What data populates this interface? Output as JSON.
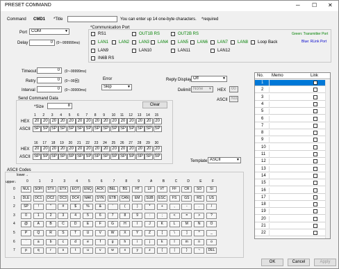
{
  "window": {
    "title": "PRESET COMMAND",
    "min": "─",
    "max": "☐",
    "close": "✕"
  },
  "command": {
    "label": "Command",
    "value": "CMD1",
    "title_label": "*Title",
    "title_value": "",
    "hint": "You can enter up 14 one-byte characters.",
    "required": "*required"
  },
  "port": {
    "label": "Port",
    "value": "COM",
    "comm_label": "*Communication Port"
  },
  "delay": {
    "label": "Delay",
    "value": "0",
    "range": "(0~-999999ms)"
  },
  "ports": [
    "RS1",
    "OUT1B RS",
    "OUT2B RS",
    "LAN1",
    "LAN2",
    "LAN3",
    "LAN4",
    "LAN5",
    "LAN6",
    "LAN7",
    "LAN8",
    "Loop Back",
    "LAN9",
    "LAN10",
    "LAN11",
    "LAN12",
    "IN6B RS"
  ],
  "legend": {
    "green": "Green: Transmitter Port",
    "blue": "Blue: RLink Port",
    "green_color": "#008000",
    "blue_color": "#0000cc"
  },
  "timeout": {
    "label": "Timeout",
    "value": "0",
    "range": "(0~-99999ms)"
  },
  "retry": {
    "label": "Retry",
    "value": "0",
    "range": "(0~-99回)"
  },
  "interval": {
    "label": "Interval",
    "value": "0",
    "range": "(0~-30000ms)"
  },
  "error": {
    "label": "Error",
    "value": "Skip"
  },
  "reply": {
    "label": "Reply Display",
    "value": "Off"
  },
  "delimit": {
    "label": "Delimit",
    "value": "None",
    "hex_label": "HEX",
    "hex_value": "00",
    "ascii_label": "ASCII",
    "ascii_value": "NUL"
  },
  "send": {
    "label": "Send Command Data",
    "size_label": "*Size",
    "size_value": "8",
    "clear": "Clear",
    "hex_label": "HEX",
    "ascii_label": "ASCII",
    "row1_nums": [
      "1",
      "2",
      "3",
      "4",
      "5",
      "6",
      "7",
      "8",
      "9",
      "10",
      "11",
      "12",
      "13",
      "14",
      "15"
    ],
    "row2_nums": [
      "16",
      "17",
      "18",
      "19",
      "20",
      "21",
      "22",
      "23",
      "24",
      "25",
      "26",
      "27",
      "28",
      "29",
      "30"
    ],
    "hex_cell": "20",
    "ascii_cell": "SP"
  },
  "template": {
    "label": "Template",
    "value": "ASCII"
  },
  "codes": {
    "label": "ASCII Codes",
    "lower": "lower→",
    "upper": "upper↓",
    "cols": [
      "0",
      "1",
      "2",
      "3",
      "4",
      "5",
      "6",
      "7",
      "8",
      "9",
      "A",
      "B",
      "C",
      "D",
      "E",
      "F"
    ],
    "rows": [
      [
        "NUL",
        "SOH",
        "STX",
        "ETX",
        "EOT",
        "ENQ",
        "ACK",
        "BEL",
        "BS",
        "HT",
        "LF",
        "VT",
        "FF",
        "CR",
        "SO",
        "SI"
      ],
      [
        "DLE",
        "DC1",
        "DC2",
        "DC3",
        "DC4",
        "NAK",
        "SYN",
        "ETB",
        "CAN",
        "EM",
        "SUB",
        "ESC",
        "FS",
        "GS",
        "RS",
        "US"
      ],
      [
        "SP",
        "!",
        "\"",
        "#",
        "$",
        "%",
        "&",
        "'",
        "(",
        ")",
        "*",
        "+",
        ",",
        "-",
        ".",
        "/"
      ],
      [
        "0",
        "1",
        "2",
        "3",
        "4",
        "5",
        "6",
        "7",
        "8",
        "9",
        ":",
        ";",
        "<",
        "=",
        ">",
        "?"
      ],
      [
        "@",
        "A",
        "B",
        "C",
        "D",
        "E",
        "F",
        "G",
        "H",
        "I",
        "J",
        "K",
        "L",
        "M",
        "N",
        "O"
      ],
      [
        "P",
        "Q",
        "R",
        "S",
        "T",
        "U",
        "V",
        "W",
        "X",
        "Y",
        "Z",
        "[",
        "\\",
        "]",
        "^",
        "_"
      ],
      [
        "`",
        "a",
        "b",
        "c",
        "d",
        "e",
        "f",
        "g",
        "h",
        "i",
        "j",
        "k",
        "l",
        "m",
        "n",
        "o"
      ],
      [
        "p",
        "q",
        "r",
        "s",
        "t",
        "u",
        "v",
        "w",
        "x",
        "y",
        "z",
        "{",
        "|",
        "}",
        "~",
        "DEL"
      ]
    ]
  },
  "list": {
    "cols": [
      "No.",
      "Memo",
      "Link"
    ],
    "rows": [
      "1",
      "2",
      "3",
      "4",
      "5",
      "6",
      "7",
      "8",
      "9",
      "10",
      "11",
      "12",
      "13",
      "14",
      "15",
      "16",
      "17",
      "18",
      "19",
      "20",
      "21",
      "22"
    ],
    "selected_color": "#0078d7"
  },
  "buttons": {
    "ok": "OK",
    "cancel": "Cancel",
    "apply": "Apply"
  }
}
